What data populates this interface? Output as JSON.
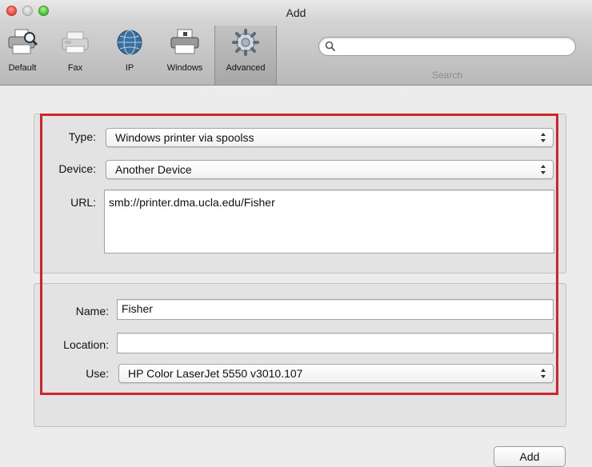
{
  "window": {
    "title": "Add",
    "traffic_lights": [
      "close",
      "minimize",
      "zoom"
    ]
  },
  "toolbar": {
    "items": [
      {
        "label": "Default",
        "icon": "printer-search-icon"
      },
      {
        "label": "Fax",
        "icon": "fax-icon"
      },
      {
        "label": "IP",
        "icon": "globe-icon"
      },
      {
        "label": "Windows",
        "icon": "windows-printer-icon"
      },
      {
        "label": "Advanced",
        "icon": "gear-icon",
        "active": true
      }
    ],
    "search": {
      "label": "Search",
      "value": "",
      "placeholder": ""
    }
  },
  "form": {
    "type": {
      "label": "Type:",
      "value": "Windows printer via spoolss"
    },
    "device": {
      "label": "Device:",
      "value": "Another Device"
    },
    "url": {
      "label": "URL:",
      "value": "smb://printer.dma.ucla.edu/Fisher"
    },
    "name": {
      "label": "Name:",
      "value": "Fisher"
    },
    "location": {
      "label": "Location:",
      "value": ""
    },
    "use": {
      "label": "Use:",
      "value": "HP Color LaserJet 5550 v3010.107"
    }
  },
  "buttons": {
    "add": "Add"
  },
  "colors": {
    "highlight": "#d2232a"
  }
}
